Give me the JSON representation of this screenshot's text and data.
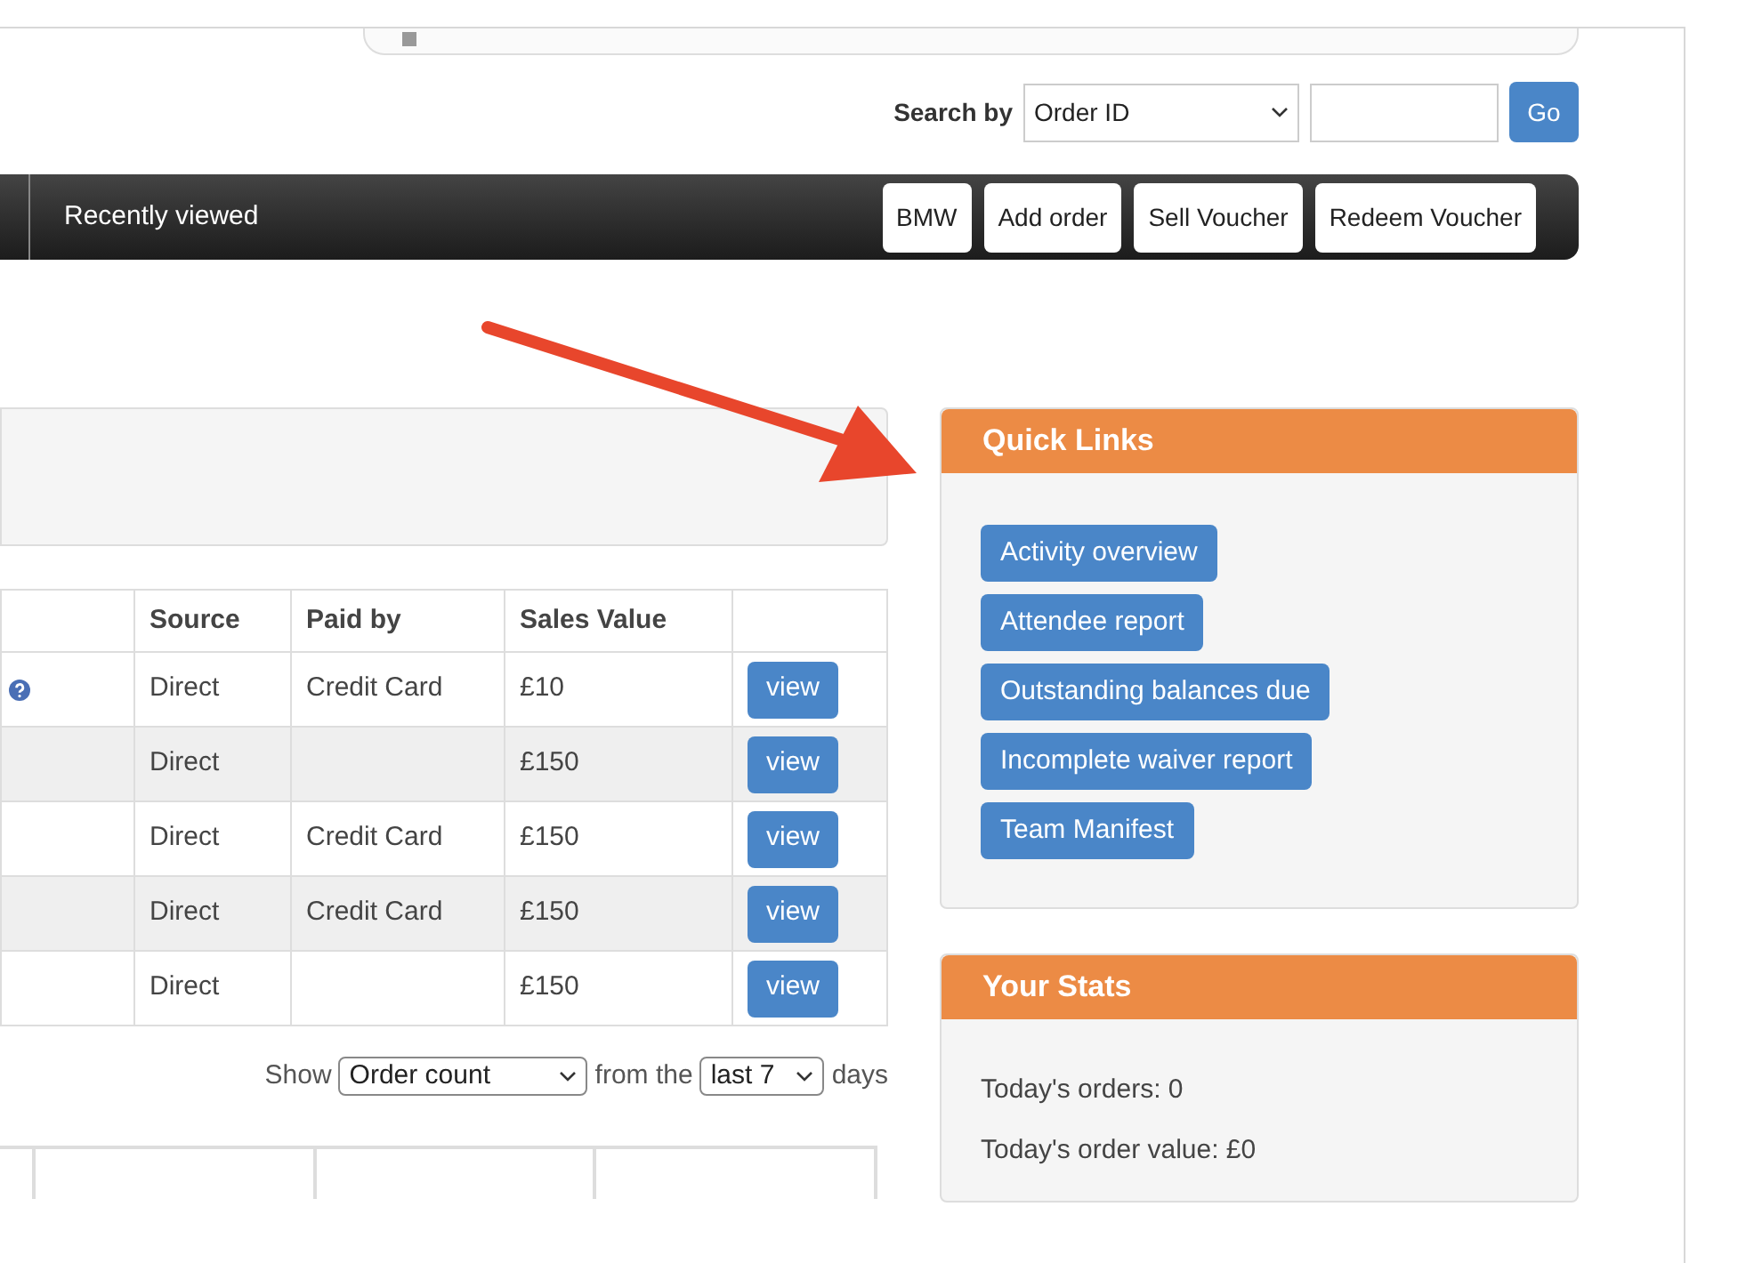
{
  "search": {
    "label": "Search by",
    "field": "Order ID",
    "button": "Go"
  },
  "navbar": {
    "items": [
      "Recently viewed"
    ],
    "buttons": [
      "BMW",
      "Add order",
      "Sell Voucher",
      "Redeem Voucher"
    ]
  },
  "orders_table": {
    "columns": [
      "",
      "Source",
      "Paid by",
      "Sales Value",
      ""
    ],
    "rows": [
      {
        "help": true,
        "source": "Direct",
        "paid_by": "Credit Card",
        "sales_value": "£10",
        "action": "view"
      },
      {
        "help": false,
        "source": "Direct",
        "paid_by": "",
        "sales_value": "£150",
        "action": "view"
      },
      {
        "help": false,
        "source": "Direct",
        "paid_by": "Credit Card",
        "sales_value": "£150",
        "action": "view"
      },
      {
        "help": false,
        "source": "Direct",
        "paid_by": "Credit Card",
        "sales_value": "£150",
        "action": "view"
      },
      {
        "help": false,
        "source": "Direct",
        "paid_by": "",
        "sales_value": "£150",
        "action": "view"
      }
    ]
  },
  "chart_controls": {
    "show_label": "Show",
    "metric": "Order count",
    "from_label": "from the",
    "period": "last 7",
    "days_label": "days"
  },
  "quick_links": {
    "title": "Quick Links",
    "links": [
      "Activity overview",
      "Attendee report",
      "Outstanding balances due",
      "Incomplete waiver report",
      "Team Manifest"
    ]
  },
  "your_stats": {
    "title": "Your Stats",
    "lines": [
      "Today's orders: 0",
      "Today's order value: £0"
    ]
  }
}
